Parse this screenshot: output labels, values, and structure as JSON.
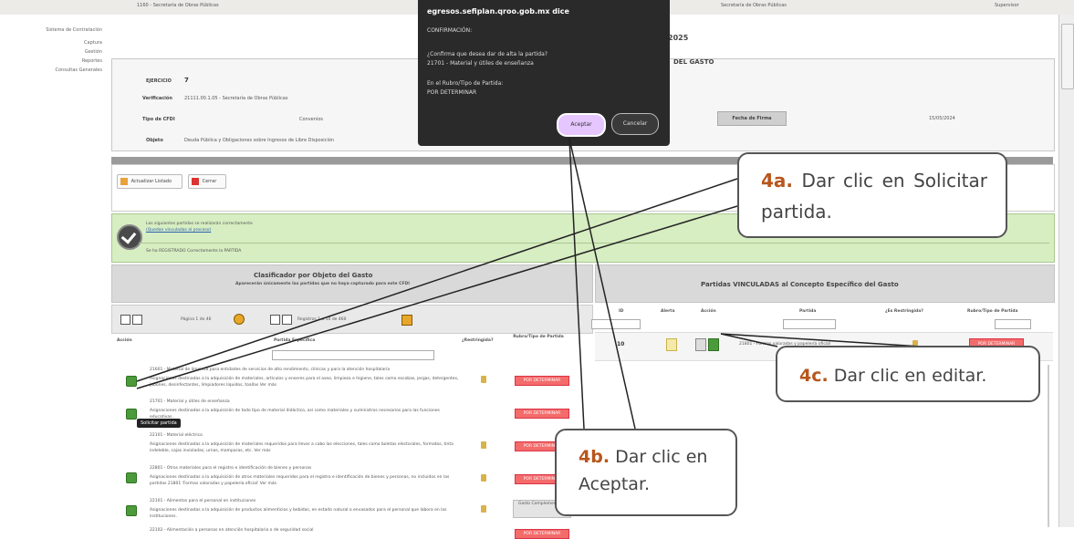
{
  "topbar": {
    "left": "1160 - Secretaría de Obras Públicas",
    "mid": "Secretaría de Obras Públicas",
    "right": "Supervisor"
  },
  "nav": {
    "header": "Sistema de Contratación",
    "items": [
      "Captura",
      "Gestión",
      "Reportes",
      "Consultas Generales"
    ]
  },
  "page": {
    "title_frag": "2025",
    "subtitle_frag": "DEL GASTO"
  },
  "header_fields": {
    "ejercicio_label": "EJERCICIO",
    "ejercicio_value": "7",
    "verificacion_label": "Verificación",
    "verificacion_value": "21111.00.1.05 - Secretaría de Obras Públicas",
    "tipo_label": "Tipo de CFDI",
    "tipo_value": "Convenios",
    "fecha_label": "Fecha de Firma",
    "fecha_value": "15/05/2024",
    "objeto_label": "Objeto",
    "objeto_value": "Deuda Pública y Obligaciones sobre Ingresos de Libre Disposición"
  },
  "toolbar": {
    "btn1": "Actualizar Listado",
    "btn2": "Cerrar"
  },
  "notice": {
    "line1": "Las siguientes partidas se realizarán correctamente",
    "line2": "(Quedan vinculadas al proceso)",
    "line3": "Se ha REGISTRADO Correctamente la PARTIDA"
  },
  "left_table": {
    "title": "Clasificador por Objeto del Gasto",
    "subtitle": "Aparecerán únicamente las partidas que no haya capturado para este CFDI",
    "pager": "Página 1 de 46",
    "records": "Registros 1 a 10 de 460",
    "col_accion": "Acción",
    "col_partida": "Partida Específica",
    "col_restr": "¿Restringida?",
    "col_rubro": "Rubro/Tipo de Partida",
    "rows": [
      {
        "title": "21601 - Material de limpieza para entidades de servicios de alto rendimiento, clínicas y para la atención hospitalaria",
        "desc": "Asignaciones destinadas a la adquisición de materiales, artículos y enseres para el aseo, limpieza e higiene, tales como escobas, jergas, detergentes, jabones, desinfectantes, limpiadores líquidos, toallas Ver más",
        "rubro": "POR DETERMINAR"
      },
      {
        "title": "21701 - Material y útiles de enseñanza",
        "desc": "Asignaciones destinadas a la adquisición de todo tipo de material didáctico, así como materiales y suministros necesarios para las funciones educativas.",
        "rubro": "POR DETERMINAR"
      },
      {
        "title": "22101 - Material eléctrico",
        "desc": "Asignaciones destinadas a la adquisición de materiales requeridos para llevar a cabo las elecciones, tales como boletas electorales, formatos, tinta indeleble, cajas invioladas, urnas, mamparas, etc. Ver más",
        "rubro": "POR DETERMINAR"
      },
      {
        "title": "22801 - Otros materiales para el registro e identificación de bienes y personas",
        "desc": "Asignaciones destinadas a la adquisición de otros materiales requeridos para el registro e identificación de bienes y personas, no incluidos en las partidas 21801 'Formas valoradas y papelería oficial' Ver más",
        "rubro": "POR DETERMINAR"
      },
      {
        "title": "22101 - Alimentos para el personal en instituciones",
        "desc": "Asignaciones destinadas a la adquisición de productos alimenticios y bebidas, en estado natural o envasados para el personal que labora en las instituciones.",
        "rubro": "Gasto Complementario"
      },
      {
        "title": "22102 - Alimentación a personas en atención hospitalaria o de seguridad social",
        "desc": "",
        "rubro": "POR DETERMINAR"
      }
    ],
    "tooltip": "Solicitar partida"
  },
  "right_table": {
    "title": "Partidas VINCULADAS al Concepto Específico del Gasto",
    "col_id": "ID",
    "col_alerta": "Alerta",
    "col_accion": "Acción",
    "col_partida": "Partida",
    "col_restr": "¿Es Restringida?",
    "col_rubro": "Rubro/Tipo de Partida",
    "row": {
      "id": "10",
      "partida": "21801 - Formas valoradas y papelería oficial",
      "rubro": "POR DETERMINAR"
    }
  },
  "dialog": {
    "host": "egresos.sefiplan.qroo.gob.mx dice",
    "title": "CONFIRMACIÓN:",
    "q1": "¿Confirma que desea dar de alta la partida?",
    "q2": "21701 - Material y útiles de enseñanza",
    "q3": "En el Rubro/Tipo de Partida:",
    "q4": "POR DETERMINAR",
    "accept": "Aceptar",
    "cancel": "Cancelar"
  },
  "callouts": {
    "a_num": "4a.",
    "a_text": " Dar clic en Solicitar partida.",
    "b_num": "4b.",
    "b_text": " Dar clic en Aceptar.",
    "c_num": "4c.",
    "c_text": " Dar clic en editar."
  },
  "colors": {
    "accent": "#b8561c",
    "green": "#4b9b3a",
    "badge": "#f36b6b",
    "dialog_accept": "#e6c6ff"
  }
}
